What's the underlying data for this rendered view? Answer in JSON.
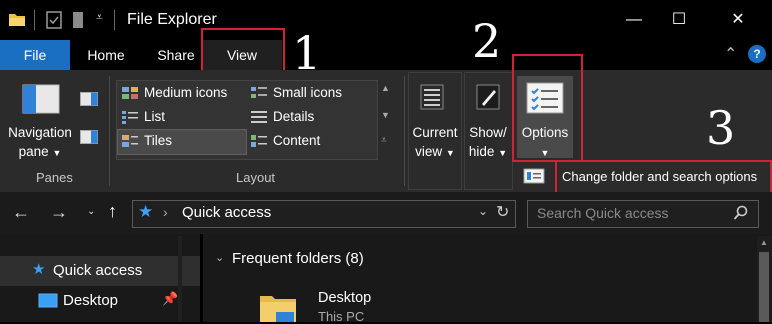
{
  "window": {
    "title": "File Explorer",
    "controls": {
      "minimize": "—",
      "maximize": "☐",
      "close": "✕"
    }
  },
  "tabs": [
    {
      "label": "File"
    },
    {
      "label": "Home"
    },
    {
      "label": "Share"
    },
    {
      "label": "View"
    }
  ],
  "ribbon": {
    "panes": {
      "navigation_pane_line1": "Navigation",
      "navigation_pane_line2": "pane",
      "group_label": "Panes"
    },
    "layout": {
      "items": [
        "Medium icons",
        "Small icons",
        "List",
        "Details",
        "Tiles",
        "Content"
      ],
      "selected": "Tiles",
      "group_label": "Layout"
    },
    "current_view": {
      "line1": "Current",
      "line2": "view"
    },
    "show_hide": {
      "line1": "Show/",
      "line2": "hide"
    },
    "options": {
      "label": "Options"
    },
    "tooltip": "Change folder and search options"
  },
  "address_bar": {
    "location": "Quick access",
    "search_placeholder": "Search Quick access"
  },
  "nav_pane": {
    "items": [
      "Quick access",
      "Desktop"
    ]
  },
  "content": {
    "section_header": "Frequent folders (8)",
    "folder_name": "Desktop",
    "folder_location": "This PC"
  },
  "annotations": [
    "1",
    "2",
    "3"
  ],
  "colors": {
    "accent": "#1a6fc2",
    "highlight_red": "#d2223a",
    "ribbon_bg": "#2b2b2b",
    "selected_bg": "#4a4a4a"
  }
}
